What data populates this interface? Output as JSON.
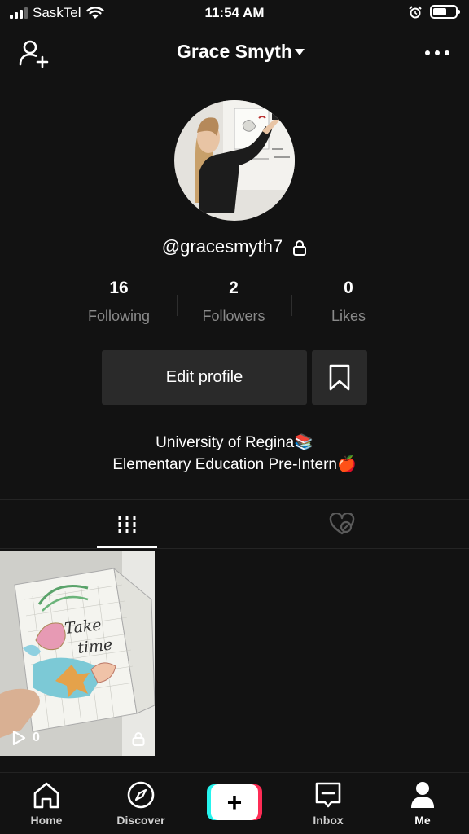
{
  "status_bar": {
    "carrier": "SaskTel",
    "time": "11:54 AM",
    "icons": [
      "signal-icon",
      "wifi-icon",
      "alarm-icon",
      "battery-icon"
    ]
  },
  "header": {
    "profile_name": "Grace Smyth",
    "left_icon": "add-user-icon",
    "right_icon": "more-icon"
  },
  "profile": {
    "handle": "@gracesmyth7",
    "private_icon": "lock-icon",
    "stats": [
      {
        "value": "16",
        "label": "Following"
      },
      {
        "value": "2",
        "label": "Followers"
      },
      {
        "value": "0",
        "label": "Likes"
      }
    ],
    "edit_label": "Edit profile",
    "bookmark_icon": "bookmark-icon",
    "bio": [
      "University of Regina📚",
      "Elementary Education Pre-Intern🍎"
    ]
  },
  "tabs": [
    {
      "icon": "grid-icon",
      "active": true
    },
    {
      "icon": "liked-icon",
      "active": false
    }
  ],
  "videos": [
    {
      "views": "0",
      "private": true,
      "thumbnail_text": "Take time"
    }
  ],
  "bottom_nav": [
    {
      "label": "Home",
      "icon": "home-icon"
    },
    {
      "label": "Discover",
      "icon": "compass-icon"
    },
    {
      "label": "",
      "icon": "create-icon"
    },
    {
      "label": "Inbox",
      "icon": "inbox-icon"
    },
    {
      "label": "Me",
      "icon": "profile-icon",
      "active": true
    }
  ],
  "colors": {
    "background": "#121212",
    "button": "#2a2a2a",
    "muted_text": "#8a8a8a",
    "create_cyan": "#25f4ee",
    "create_pink": "#fe2c55"
  }
}
